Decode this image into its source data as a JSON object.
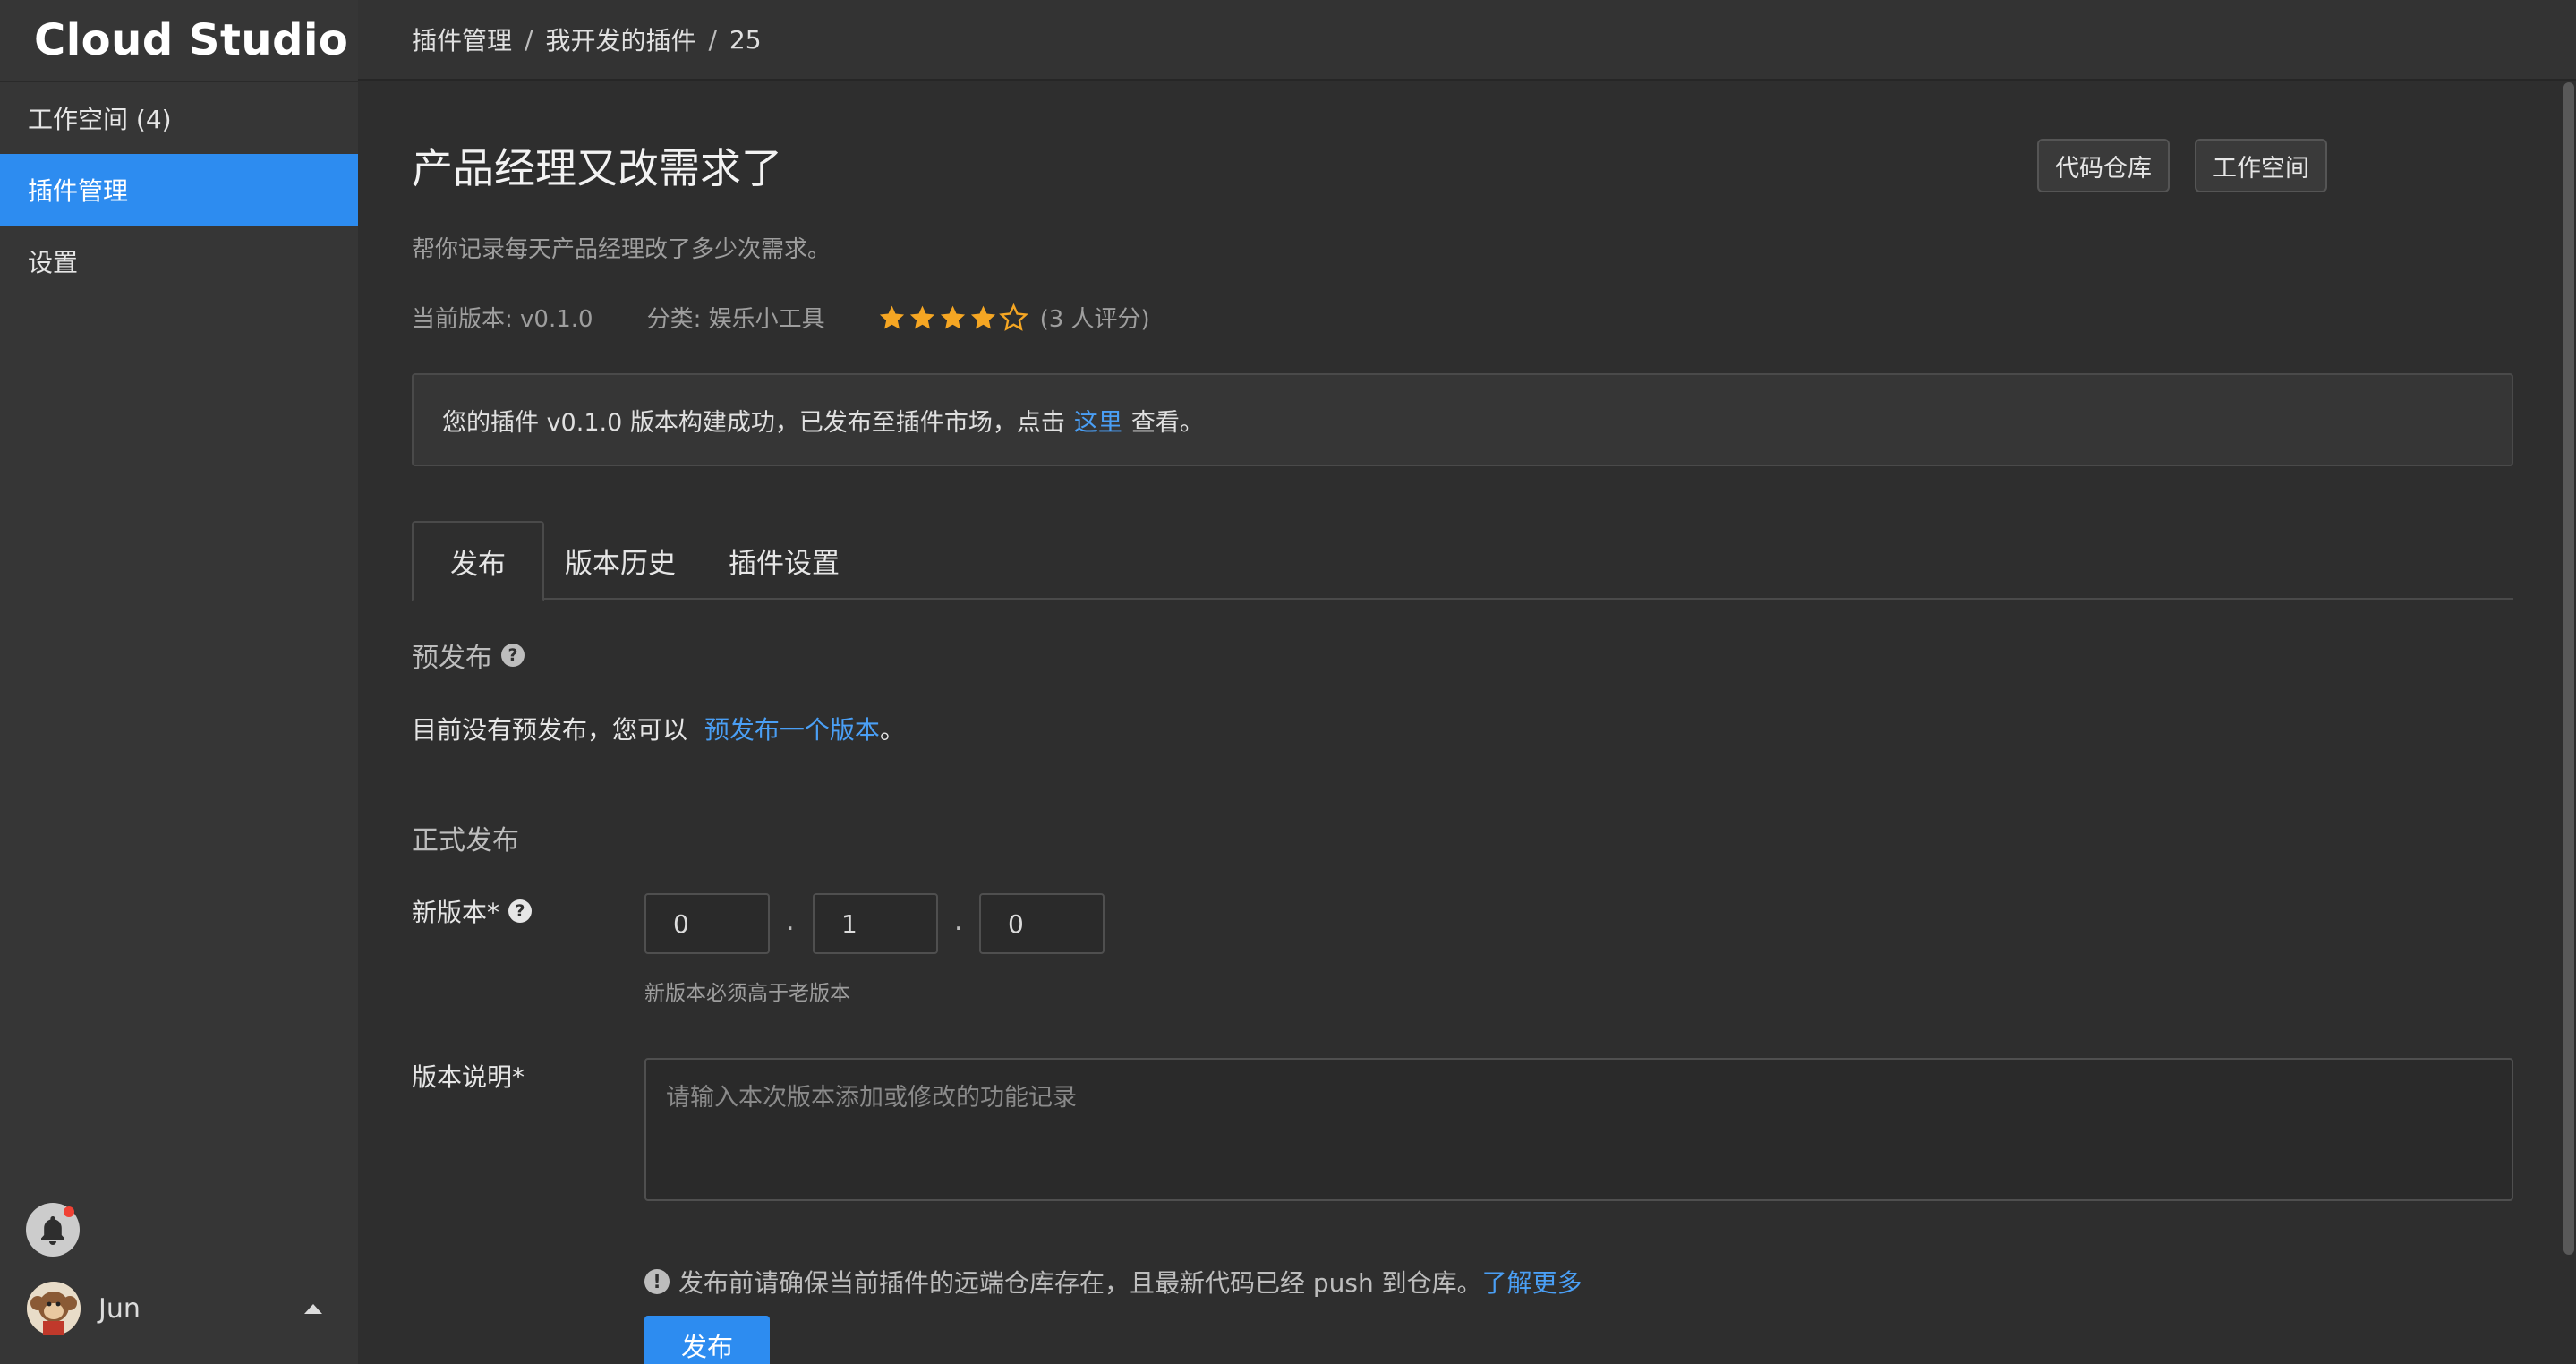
{
  "app": {
    "logo": "Cloud Studio"
  },
  "sidebar": {
    "items": [
      {
        "label": "工作空间 (4)",
        "active": false
      },
      {
        "label": "插件管理",
        "active": true
      },
      {
        "label": "设置",
        "active": false
      }
    ],
    "user": {
      "name": "Jun"
    }
  },
  "breadcrumb": {
    "items": [
      "插件管理",
      "我开发的插件",
      "25"
    ],
    "separator": "/"
  },
  "plugin": {
    "title": "产品经理又改需求了",
    "description": "帮你记录每天产品经理改了多少次需求。",
    "version_text": "当前版本: v0.1.0",
    "category_text": "分类: 娱乐小工具",
    "rating": 4,
    "rating_max": 5,
    "rating_count_text": "(3 人评分)"
  },
  "header_buttons": {
    "repo": "代码仓库",
    "workspace": "工作空间"
  },
  "notice": {
    "prefix": "您的插件 v0.1.0 版本构建成功，已发布至插件市场，点击",
    "link": "这里",
    "suffix": "查看。"
  },
  "tabs": [
    {
      "label": "发布",
      "active": true
    },
    {
      "label": "版本历史",
      "active": false
    },
    {
      "label": "插件设置",
      "active": false
    }
  ],
  "prerelease": {
    "title": "预发布",
    "text": "目前没有预发布，您可以",
    "link": "预发布一个版本",
    "end": "。"
  },
  "release": {
    "title": "正式发布",
    "version_label": "新版本*",
    "version": {
      "major": "0",
      "minor": "1",
      "patch": "0"
    },
    "version_separator": ".",
    "version_hint": "新版本必须高于老版本",
    "notes_label": "版本说明*",
    "notes_placeholder": "请输入本次版本添加或修改的功能记录",
    "warning": "发布前请确保当前插件的远端仓库存在，且最新代码已经 push 到仓库。",
    "warning_link": "了解更多",
    "publish_button": "发布"
  },
  "colors": {
    "accent": "#2d8cf0",
    "link": "#4a9ff5",
    "star": "#f5a623",
    "background": "#2e2e2e",
    "sidebar": "#363636"
  }
}
